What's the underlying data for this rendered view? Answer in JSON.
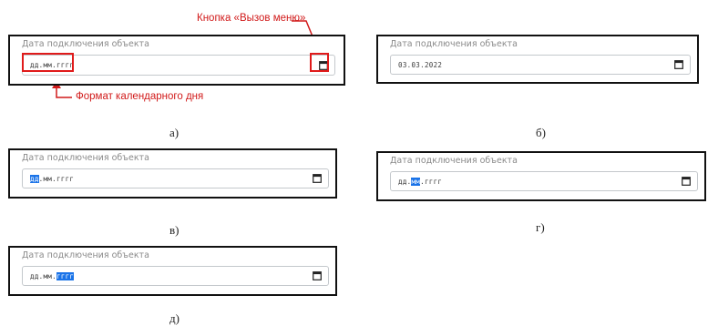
{
  "field_label": "Дата подключения объекта",
  "annotations": {
    "menu_button": "Кнопка «Вызов меню»",
    "date_format": "Формат календарного дня"
  },
  "panels": {
    "a": {
      "caption": "а)",
      "segments": [
        "дд",
        ".",
        "мм",
        ".",
        "гггг"
      ],
      "selected": null
    },
    "b": {
      "caption": "б)",
      "segments": [
        "03",
        ".",
        "03",
        ".",
        "2022"
      ],
      "selected": null
    },
    "v": {
      "caption": "в)",
      "segments": [
        "дд",
        ".",
        "мм",
        ".",
        "гггг"
      ],
      "selected": 0
    },
    "g": {
      "caption": "г)",
      "segments": [
        "дд",
        ".",
        "мм",
        ".",
        "гггг"
      ],
      "selected": 2
    },
    "d": {
      "caption": "д)",
      "segments": [
        "дд",
        ".",
        "мм",
        ".",
        "гггг"
      ],
      "selected": 4
    }
  },
  "icons": {
    "calendar": "calendar-icon"
  },
  "colors": {
    "highlight": "#e01b1b",
    "selection": "#1a73e8"
  }
}
